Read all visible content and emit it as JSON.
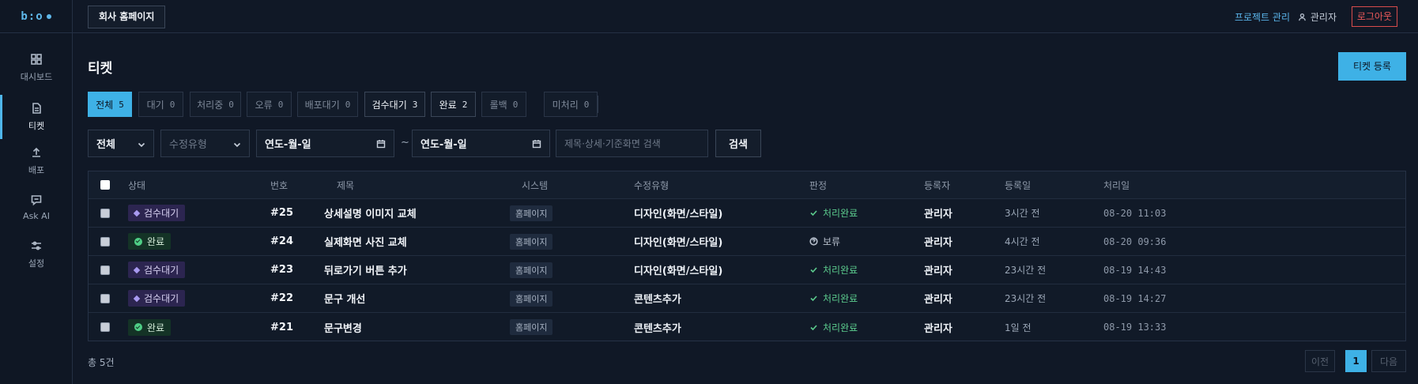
{
  "sidebar": {
    "logo": "b:o",
    "items": [
      {
        "label": "대시보드",
        "icon": "grid-icon"
      },
      {
        "label": "티켓",
        "icon": "document-icon"
      },
      {
        "label": "배포",
        "icon": "upload-icon"
      },
      {
        "label": "Ask AI",
        "icon": "chat-icon"
      },
      {
        "label": "설정",
        "icon": "sliders-icon"
      }
    ]
  },
  "topbar": {
    "site_button": "회사 홈페이지",
    "project_link": "프로젝트 관리",
    "user_name": "관리자",
    "logout": "로그아웃"
  },
  "page": {
    "title": "티켓",
    "register_button": "티켓 등록"
  },
  "tabs": [
    {
      "label": "전체",
      "count": "5"
    },
    {
      "label": "대기",
      "count": "0"
    },
    {
      "label": "처리중",
      "count": "0"
    },
    {
      "label": "오류",
      "count": "0"
    },
    {
      "label": "배포대기",
      "count": "0"
    },
    {
      "label": "검수대기",
      "count": "3"
    },
    {
      "label": "완료",
      "count": "2"
    },
    {
      "label": "롤백",
      "count": "0"
    },
    {
      "label": "미처리",
      "count": "0"
    }
  ],
  "filters": {
    "system": "전체",
    "mod_type_placeholder": "수정유형",
    "date_from": "연도-월-일",
    "date_to": "연도-월-일",
    "range_sep": "~",
    "search_placeholder": "제목·상세·기준화면 검색",
    "search_button": "검색"
  },
  "table": {
    "headers": {
      "status": "상태",
      "number": "번호",
      "title": "제목",
      "system": "시스템",
      "mod_type": "수정유형",
      "judgment": "판정",
      "registrant": "등록자",
      "reg_date": "등록일",
      "proc_date": "처리일"
    },
    "rows": [
      {
        "status": "검수대기",
        "status_kind": "review",
        "number": "#25",
        "title": "상세설명 이미지 교체",
        "system": "홈페이지",
        "mod_type": "디자인(화면/스타일)",
        "judgment": "처리완료",
        "judgment_kind": "ok",
        "registrant": "관리자",
        "reg_date": "3시간 전",
        "proc_date": "08-20 11:03"
      },
      {
        "status": "완료",
        "status_kind": "done",
        "number": "#24",
        "title": "실제화면 사진 교체",
        "system": "홈페이지",
        "mod_type": "디자인(화면/스타일)",
        "judgment": "보류",
        "judgment_kind": "hold",
        "registrant": "관리자",
        "reg_date": "4시간 전",
        "proc_date": "08-20 09:36"
      },
      {
        "status": "검수대기",
        "status_kind": "review",
        "number": "#23",
        "title": "뒤로가기 버튼 추가",
        "system": "홈페이지",
        "mod_type": "디자인(화면/스타일)",
        "judgment": "처리완료",
        "judgment_kind": "ok",
        "registrant": "관리자",
        "reg_date": "23시간 전",
        "proc_date": "08-19 14:43"
      },
      {
        "status": "검수대기",
        "status_kind": "review",
        "number": "#22",
        "title": "문구 개선",
        "system": "홈페이지",
        "mod_type": "콘텐츠추가",
        "judgment": "처리완료",
        "judgment_kind": "ok",
        "registrant": "관리자",
        "reg_date": "23시간 전",
        "proc_date": "08-19 14:27"
      },
      {
        "status": "완료",
        "status_kind": "done",
        "number": "#21",
        "title": "문구변경",
        "system": "홈페이지",
        "mod_type": "콘텐츠추가",
        "judgment": "처리완료",
        "judgment_kind": "ok",
        "registrant": "관리자",
        "reg_date": "1일 전",
        "proc_date": "08-19 13:33"
      }
    ]
  },
  "footer": {
    "total": "총 5건",
    "prev": "이전",
    "current_page": "1",
    "next": "다음"
  },
  "colors": {
    "accent": "#3eb1e6",
    "background": "#101826",
    "danger": "#ee5a5a",
    "success": "#5ccd8e",
    "review": "#a89af0"
  }
}
